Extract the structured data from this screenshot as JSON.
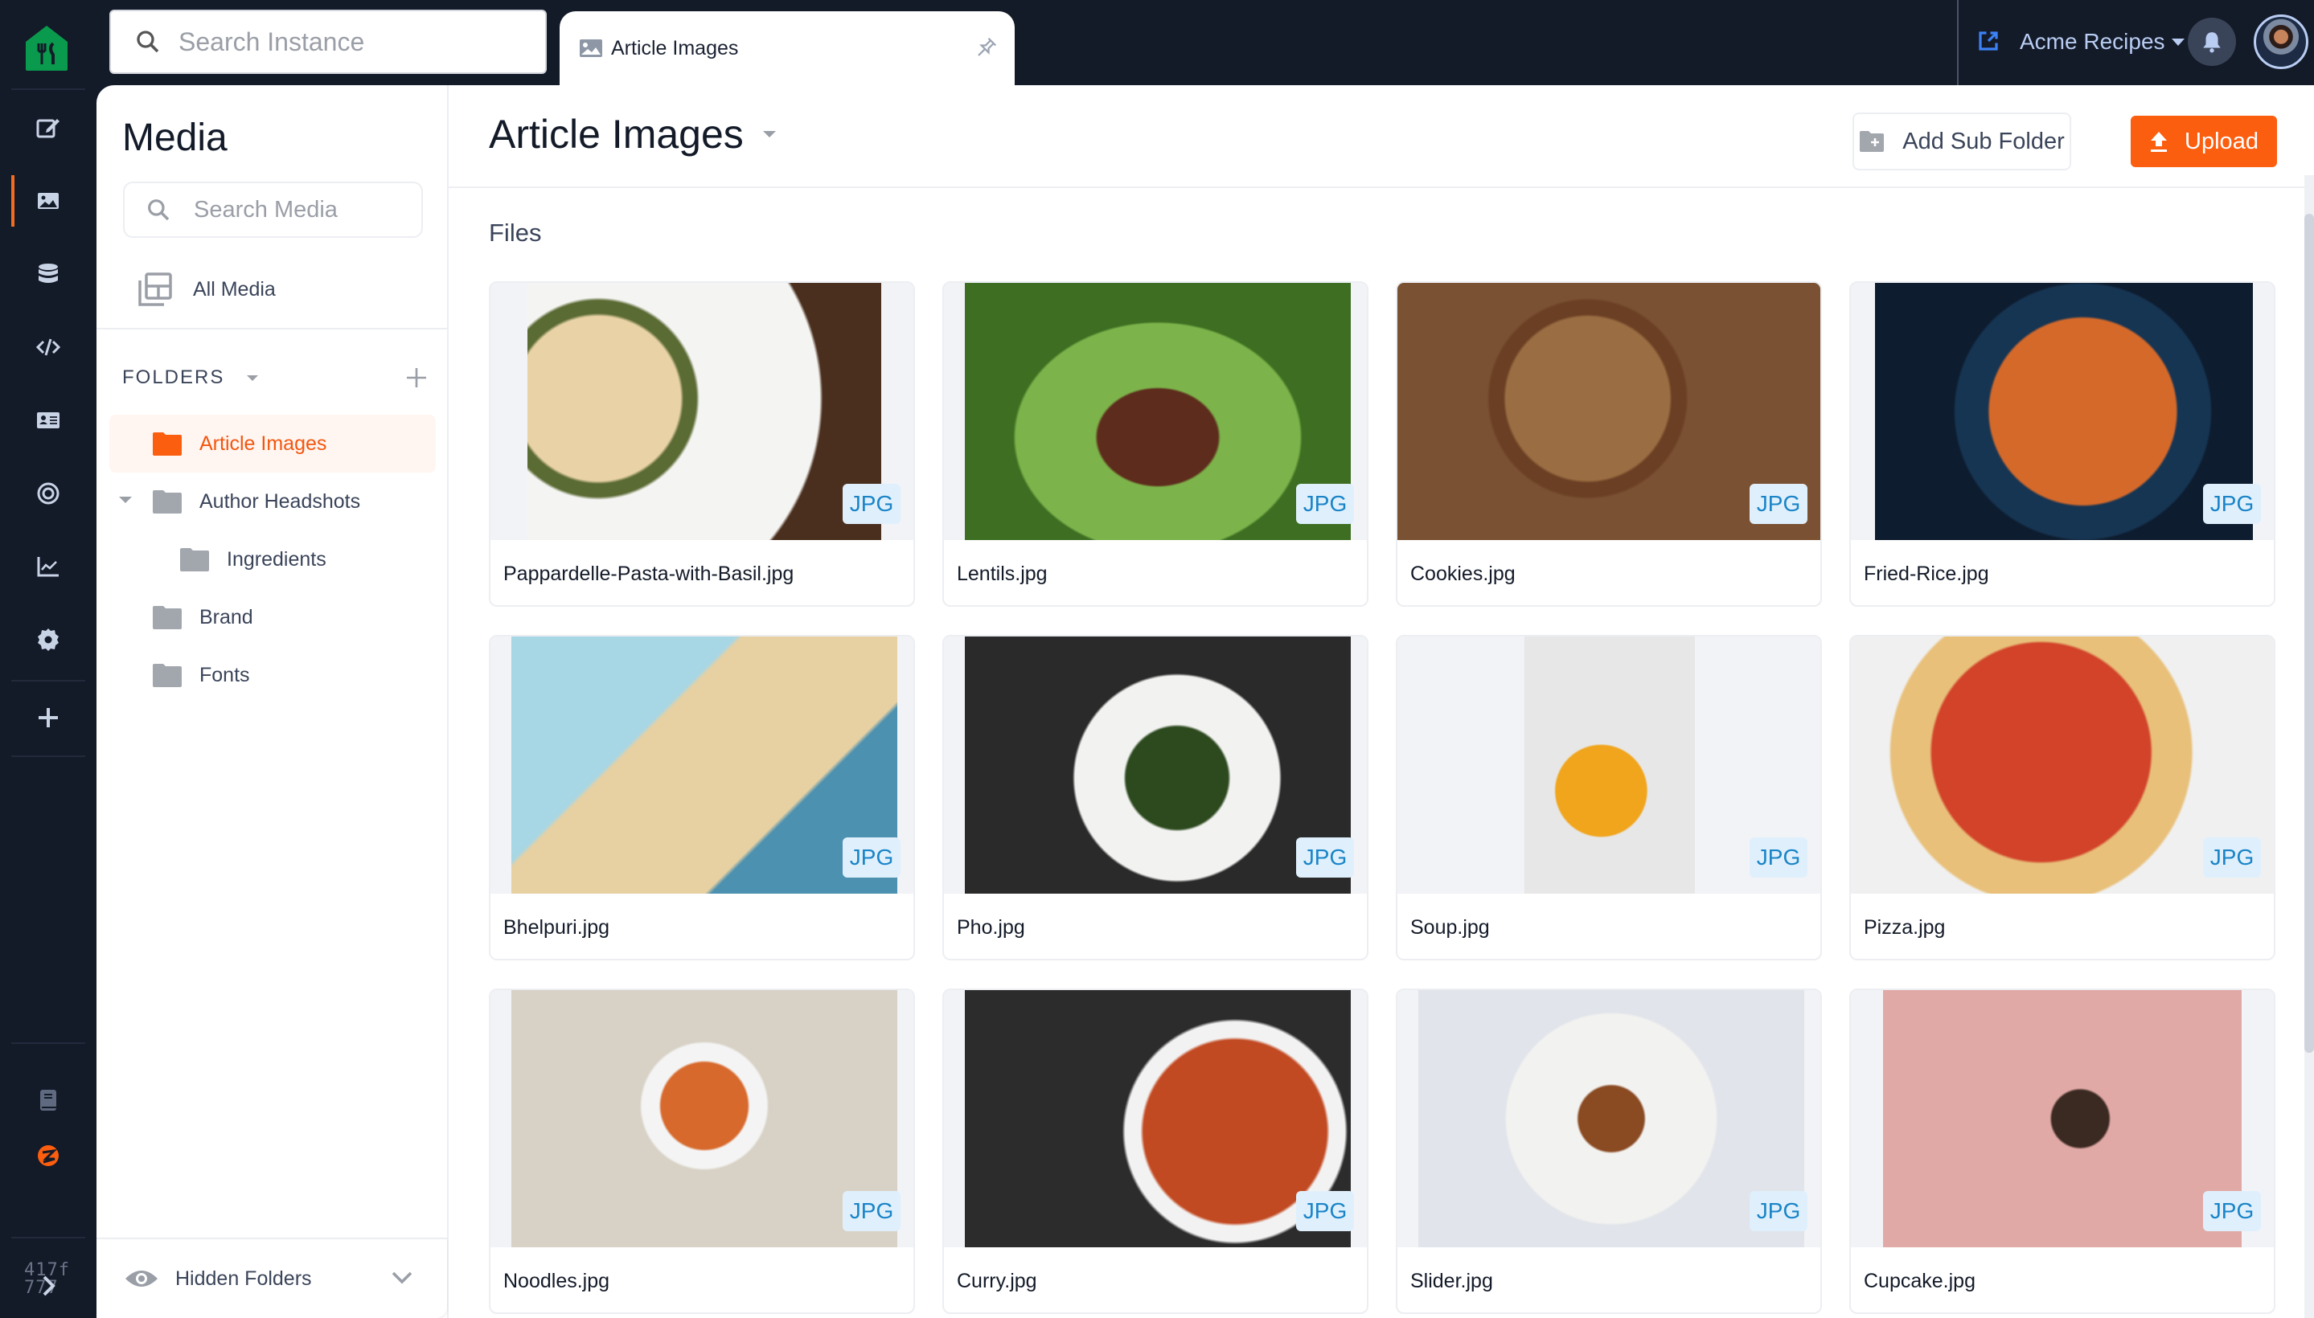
{
  "topbar": {
    "instance_search_placeholder": "Search Instance",
    "tab_label": "Article Images",
    "org_name": "Acme Recipes",
    "brand_color": "#0a9a4e"
  },
  "rail": {
    "items": [
      {
        "name": "entries",
        "icon": "edit-icon"
      },
      {
        "name": "media",
        "icon": "image-icon",
        "active": true
      },
      {
        "name": "schema",
        "icon": "database-icon"
      },
      {
        "name": "developers",
        "icon": "code-icon"
      },
      {
        "name": "users",
        "icon": "contact-card-icon"
      },
      {
        "name": "releases",
        "icon": "target-icon"
      },
      {
        "name": "reports",
        "icon": "chart-icon"
      },
      {
        "name": "settings",
        "icon": "gear-icon"
      },
      {
        "name": "add",
        "icon": "plus-icon"
      }
    ],
    "build_line1": "417f",
    "build_line2": "777",
    "accent": "#f36d21"
  },
  "media_sidebar": {
    "title": "Media",
    "search_placeholder": "Search Media",
    "all_media_label": "All Media",
    "folders_header": "FOLDERS",
    "folders": [
      {
        "label": "Article Images",
        "active": true,
        "level": 0
      },
      {
        "label": "Author Headshots",
        "expanded": true,
        "level": 0
      },
      {
        "label": "Ingredients",
        "level": 1
      },
      {
        "label": "Brand",
        "level": 0
      },
      {
        "label": "Fonts",
        "level": 0
      }
    ],
    "hidden_folders_label": "Hidden Folders"
  },
  "main": {
    "title": "Article Images",
    "add_sub_folder_label": "Add Sub Folder",
    "upload_label": "Upload",
    "upload_color": "#fc5e0f",
    "section_label": "Files",
    "files": [
      {
        "name": "Pappardelle-Pasta-with-Basil.jpg",
        "type": "JPG"
      },
      {
        "name": "Lentils.jpg",
        "type": "JPG"
      },
      {
        "name": "Cookies.jpg",
        "type": "JPG"
      },
      {
        "name": "Fried-Rice.jpg",
        "type": "JPG"
      },
      {
        "name": "Bhelpuri.jpg",
        "type": "JPG"
      },
      {
        "name": "Pho.jpg",
        "type": "JPG"
      },
      {
        "name": "Soup.jpg",
        "type": "JPG"
      },
      {
        "name": "Pizza.jpg",
        "type": "JPG"
      },
      {
        "name": "Noodles.jpg",
        "type": "JPG"
      },
      {
        "name": "Curry.jpg",
        "type": "JPG"
      },
      {
        "name": "Slider.jpg",
        "type": "JPG"
      },
      {
        "name": "Cupcake.jpg",
        "type": "JPG"
      }
    ]
  }
}
